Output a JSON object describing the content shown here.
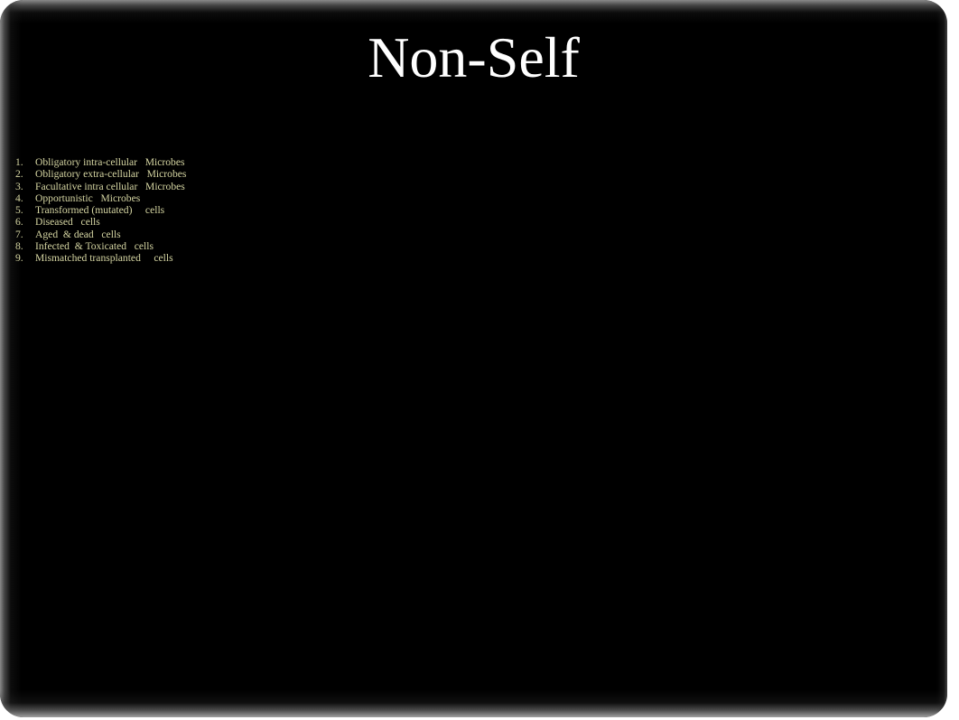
{
  "slide": {
    "title": "Non-Self",
    "background_color": "#000000",
    "title_color": "#ffffff",
    "body_text_color": "#d5d5a2",
    "page_background_color": "#ffffff"
  },
  "body_list": [
    {
      "number": "1.",
      "text": "Obligatory intra-cellular   Microbes"
    },
    {
      "number": "2.",
      "text": "Obligatory extra-cellular   Microbes"
    },
    {
      "number": "3.",
      "text": "Facultative intra cellular   Microbes"
    },
    {
      "number": "4.",
      "text": "Opportunistic   Microbes"
    },
    {
      "number": "5.",
      "text": "Transformed (mutated)     cells"
    },
    {
      "number": "6.",
      "text": "Diseased   cells"
    },
    {
      "number": "7.",
      "text": "Aged  & dead   cells"
    },
    {
      "number": "8.",
      "text": "Infected  & Toxicated   cells"
    },
    {
      "number": "9.",
      "text": "Mismatched transplanted     cells"
    }
  ]
}
